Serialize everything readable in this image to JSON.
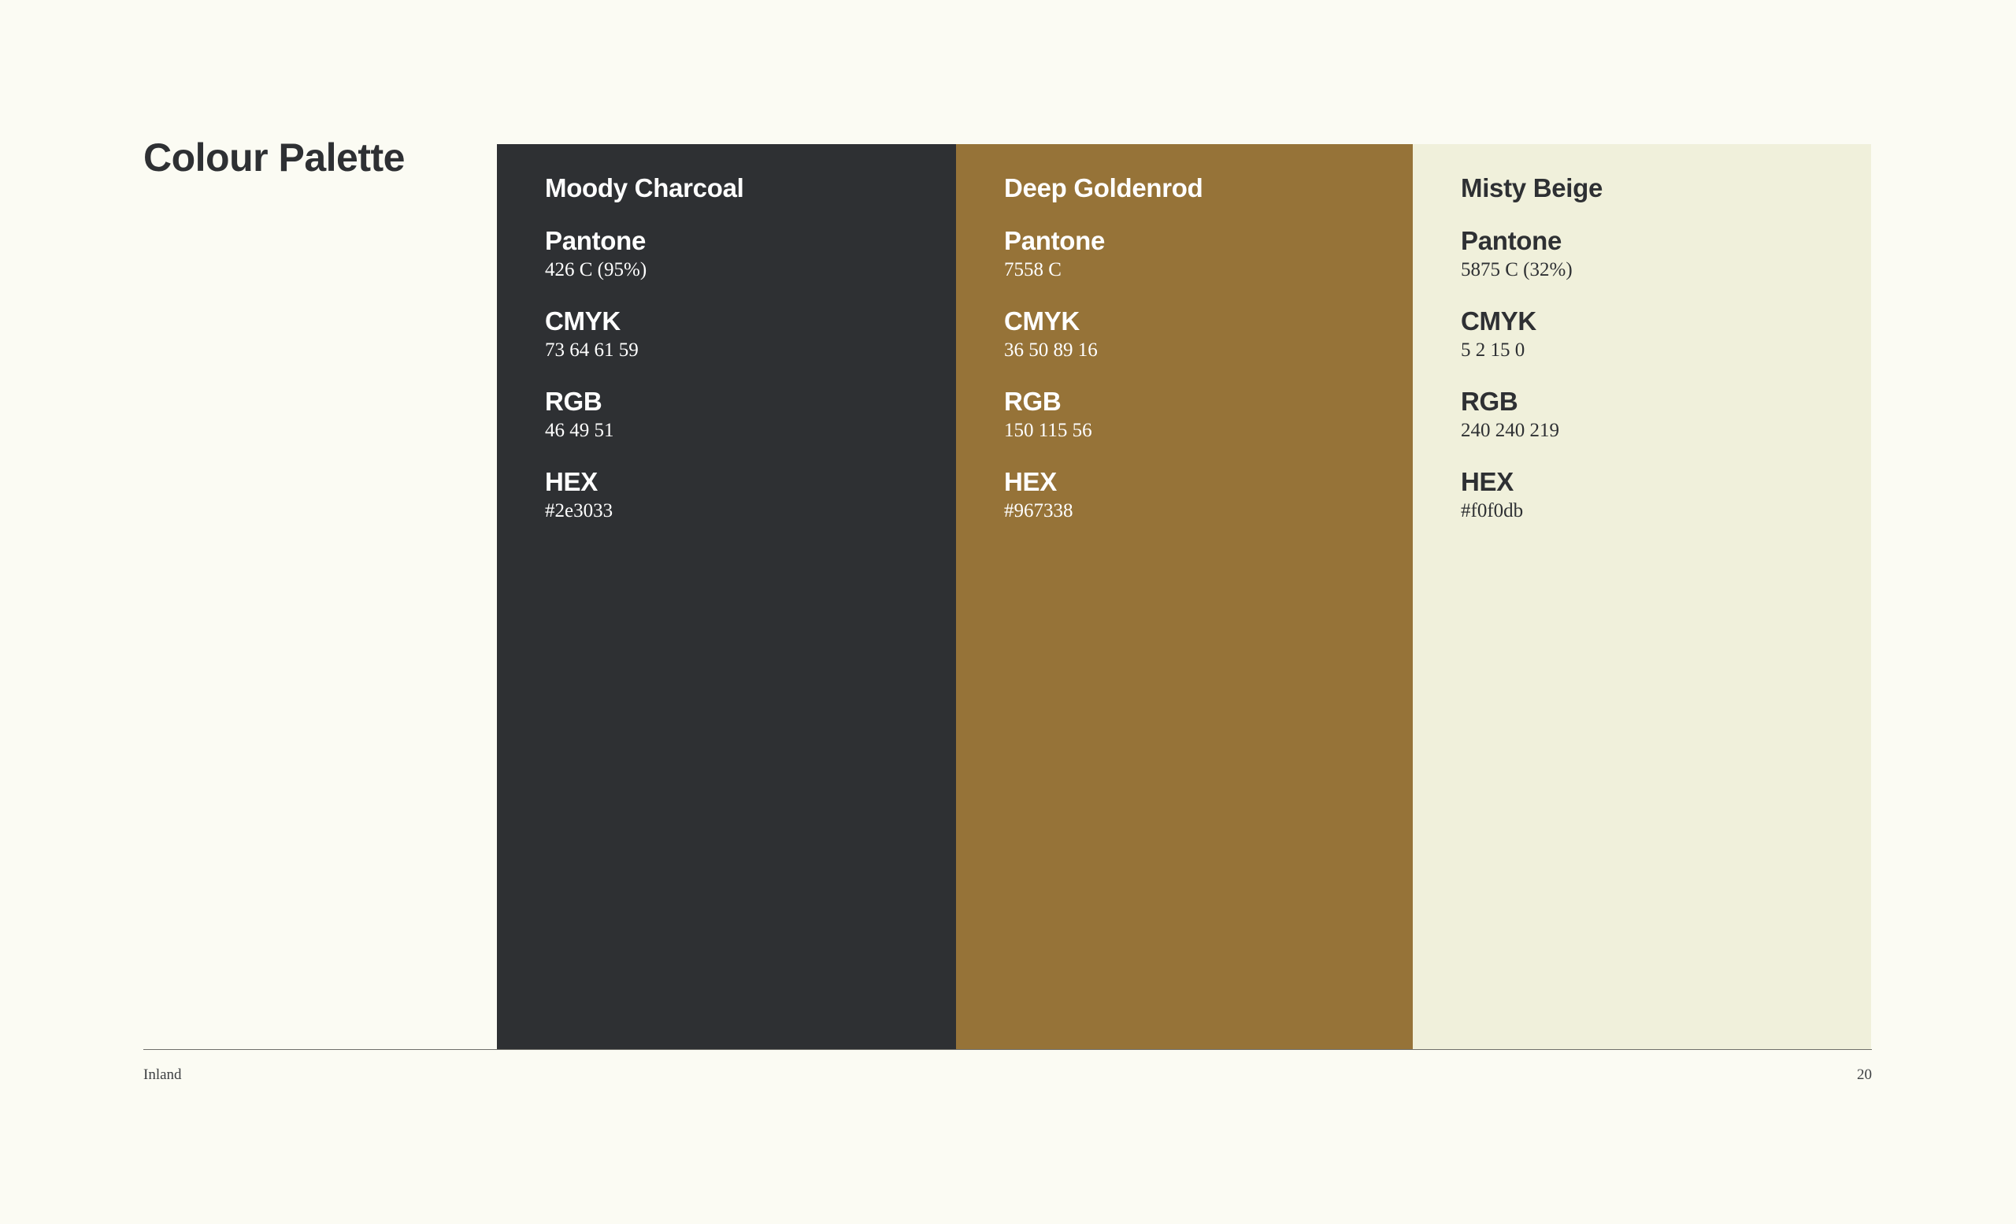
{
  "page": {
    "title": "Colour Palette",
    "footer_left": "Inland",
    "page_number": "20",
    "background": "#fbfbf3"
  },
  "swatches": [
    {
      "name": "Moody Charcoal",
      "background": "#2e3033",
      "text_color": "#ffffff",
      "specs": [
        {
          "label": "Pantone",
          "value": "426 C (95%)"
        },
        {
          "label": "CMYK",
          "value": "73 64 61 59"
        },
        {
          "label": "RGB",
          "value": "46 49 51"
        },
        {
          "label": "HEX",
          "value": "#2e3033"
        }
      ]
    },
    {
      "name": "Deep Goldenrod",
      "background": "#967338",
      "text_color": "#ffffff",
      "specs": [
        {
          "label": "Pantone",
          "value": "7558 C"
        },
        {
          "label": "CMYK",
          "value": "36 50 89 16"
        },
        {
          "label": "RGB",
          "value": "150 115 56"
        },
        {
          "label": "HEX",
          "value": "#967338"
        }
      ]
    },
    {
      "name": "Misty Beige",
      "background": "#f0f0db",
      "text_color": "#2e3033",
      "specs": [
        {
          "label": "Pantone",
          "value": "5875 C (32%)"
        },
        {
          "label": "CMYK",
          "value": "5 2 15 0"
        },
        {
          "label": "RGB",
          "value": "240 240 219"
        },
        {
          "label": "HEX",
          "value": "#f0f0db"
        }
      ]
    }
  ]
}
